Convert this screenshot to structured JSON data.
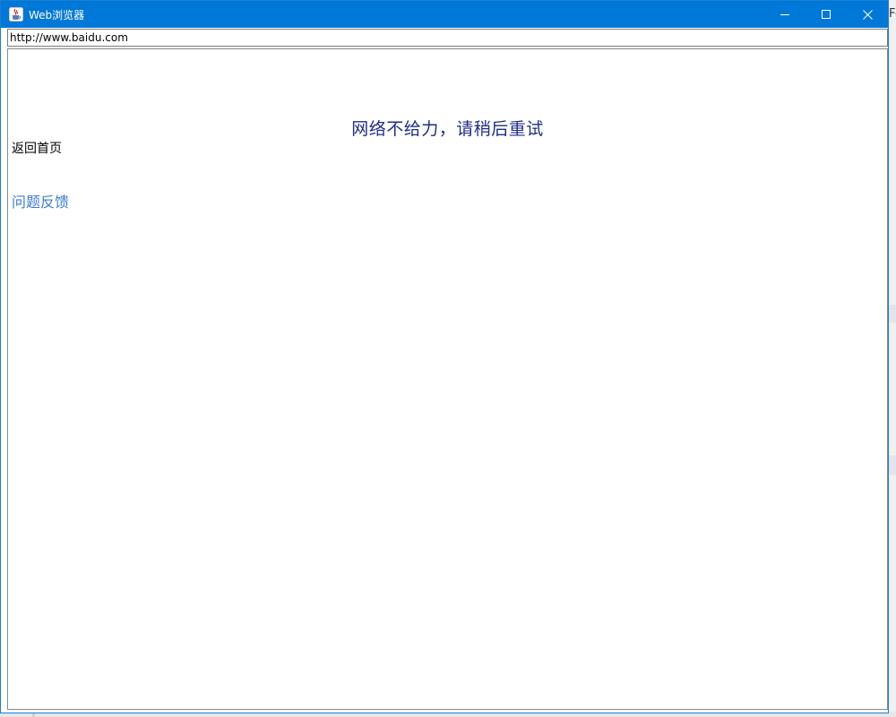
{
  "window": {
    "title": "Web浏览器",
    "app_icon": "java-cup-icon",
    "controls": {
      "minimize_icon": "minimize-icon",
      "maximize_icon": "maximize-icon",
      "close_icon": "close-icon"
    },
    "accent_color": "#0078d7"
  },
  "address_bar": {
    "value": "http://www.baidu.com"
  },
  "page": {
    "error_message": "网络不给力，请稍后重试",
    "back_home_link": "返回首页",
    "feedback_link": "问题反馈",
    "error_color": "#1f2d86",
    "link_color": "#3b7bd6"
  },
  "background": {
    "edge_text": "Fo"
  }
}
